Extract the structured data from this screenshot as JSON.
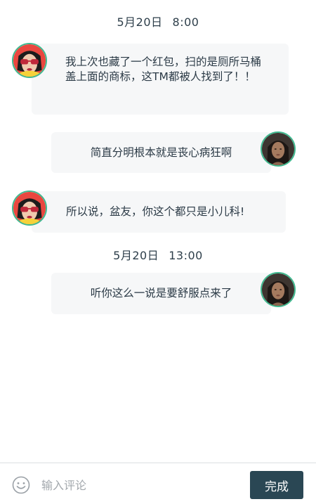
{
  "messages": [
    {
      "type": "timestamp",
      "date": "5月20日",
      "time": "8:00"
    },
    {
      "type": "bubble",
      "side": "left",
      "avatar": "woman-sunglasses-avatar",
      "text": "我上次也藏了一个红包，扫的是厕所马桶盖上面的商标，这TM都被人找到了！！"
    },
    {
      "type": "bubble",
      "side": "right",
      "avatar": "woman-portrait-avatar",
      "text": "简直分明根本就是丧心病狂啊"
    },
    {
      "type": "bubble",
      "side": "left",
      "avatar": "woman-sunglasses-avatar",
      "text": "所以说，盆友，你这个都只是小儿科!"
    },
    {
      "type": "timestamp",
      "date": "5月20日",
      "time": "13:00"
    },
    {
      "type": "bubble",
      "side": "right",
      "avatar": "woman-portrait-avatar",
      "text": "听你这么一说是要舒服点来了"
    }
  ],
  "composer": {
    "emoji_icon": "smiley-face-icon",
    "placeholder": "输入评论",
    "value": "",
    "done_label": "完成"
  },
  "colors": {
    "avatar_border": "#3fb98f",
    "bubble_bg": "#f6f7f8",
    "done_button_bg": "#2a4754",
    "text": "#2b3a46"
  }
}
